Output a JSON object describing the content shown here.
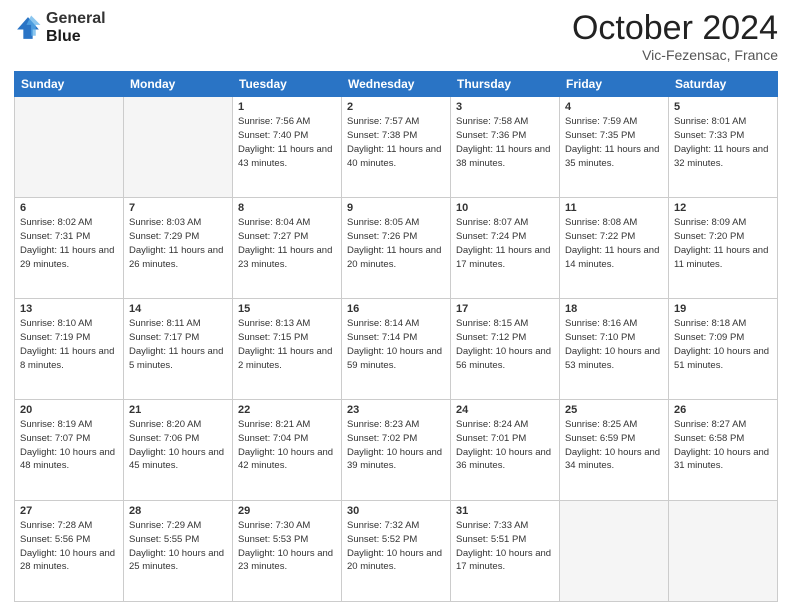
{
  "header": {
    "logo_line1": "General",
    "logo_line2": "Blue",
    "month": "October 2024",
    "location": "Vic-Fezensac, France"
  },
  "weekdays": [
    "Sunday",
    "Monday",
    "Tuesday",
    "Wednesday",
    "Thursday",
    "Friday",
    "Saturday"
  ],
  "weeks": [
    [
      {
        "day": "",
        "sunrise": "",
        "sunset": "",
        "daylight": ""
      },
      {
        "day": "",
        "sunrise": "",
        "sunset": "",
        "daylight": ""
      },
      {
        "day": "1",
        "sunrise": "Sunrise: 7:56 AM",
        "sunset": "Sunset: 7:40 PM",
        "daylight": "Daylight: 11 hours and 43 minutes."
      },
      {
        "day": "2",
        "sunrise": "Sunrise: 7:57 AM",
        "sunset": "Sunset: 7:38 PM",
        "daylight": "Daylight: 11 hours and 40 minutes."
      },
      {
        "day": "3",
        "sunrise": "Sunrise: 7:58 AM",
        "sunset": "Sunset: 7:36 PM",
        "daylight": "Daylight: 11 hours and 38 minutes."
      },
      {
        "day": "4",
        "sunrise": "Sunrise: 7:59 AM",
        "sunset": "Sunset: 7:35 PM",
        "daylight": "Daylight: 11 hours and 35 minutes."
      },
      {
        "day": "5",
        "sunrise": "Sunrise: 8:01 AM",
        "sunset": "Sunset: 7:33 PM",
        "daylight": "Daylight: 11 hours and 32 minutes."
      }
    ],
    [
      {
        "day": "6",
        "sunrise": "Sunrise: 8:02 AM",
        "sunset": "Sunset: 7:31 PM",
        "daylight": "Daylight: 11 hours and 29 minutes."
      },
      {
        "day": "7",
        "sunrise": "Sunrise: 8:03 AM",
        "sunset": "Sunset: 7:29 PM",
        "daylight": "Daylight: 11 hours and 26 minutes."
      },
      {
        "day": "8",
        "sunrise": "Sunrise: 8:04 AM",
        "sunset": "Sunset: 7:27 PM",
        "daylight": "Daylight: 11 hours and 23 minutes."
      },
      {
        "day": "9",
        "sunrise": "Sunrise: 8:05 AM",
        "sunset": "Sunset: 7:26 PM",
        "daylight": "Daylight: 11 hours and 20 minutes."
      },
      {
        "day": "10",
        "sunrise": "Sunrise: 8:07 AM",
        "sunset": "Sunset: 7:24 PM",
        "daylight": "Daylight: 11 hours and 17 minutes."
      },
      {
        "day": "11",
        "sunrise": "Sunrise: 8:08 AM",
        "sunset": "Sunset: 7:22 PM",
        "daylight": "Daylight: 11 hours and 14 minutes."
      },
      {
        "day": "12",
        "sunrise": "Sunrise: 8:09 AM",
        "sunset": "Sunset: 7:20 PM",
        "daylight": "Daylight: 11 hours and 11 minutes."
      }
    ],
    [
      {
        "day": "13",
        "sunrise": "Sunrise: 8:10 AM",
        "sunset": "Sunset: 7:19 PM",
        "daylight": "Daylight: 11 hours and 8 minutes."
      },
      {
        "day": "14",
        "sunrise": "Sunrise: 8:11 AM",
        "sunset": "Sunset: 7:17 PM",
        "daylight": "Daylight: 11 hours and 5 minutes."
      },
      {
        "day": "15",
        "sunrise": "Sunrise: 8:13 AM",
        "sunset": "Sunset: 7:15 PM",
        "daylight": "Daylight: 11 hours and 2 minutes."
      },
      {
        "day": "16",
        "sunrise": "Sunrise: 8:14 AM",
        "sunset": "Sunset: 7:14 PM",
        "daylight": "Daylight: 10 hours and 59 minutes."
      },
      {
        "day": "17",
        "sunrise": "Sunrise: 8:15 AM",
        "sunset": "Sunset: 7:12 PM",
        "daylight": "Daylight: 10 hours and 56 minutes."
      },
      {
        "day": "18",
        "sunrise": "Sunrise: 8:16 AM",
        "sunset": "Sunset: 7:10 PM",
        "daylight": "Daylight: 10 hours and 53 minutes."
      },
      {
        "day": "19",
        "sunrise": "Sunrise: 8:18 AM",
        "sunset": "Sunset: 7:09 PM",
        "daylight": "Daylight: 10 hours and 51 minutes."
      }
    ],
    [
      {
        "day": "20",
        "sunrise": "Sunrise: 8:19 AM",
        "sunset": "Sunset: 7:07 PM",
        "daylight": "Daylight: 10 hours and 48 minutes."
      },
      {
        "day": "21",
        "sunrise": "Sunrise: 8:20 AM",
        "sunset": "Sunset: 7:06 PM",
        "daylight": "Daylight: 10 hours and 45 minutes."
      },
      {
        "day": "22",
        "sunrise": "Sunrise: 8:21 AM",
        "sunset": "Sunset: 7:04 PM",
        "daylight": "Daylight: 10 hours and 42 minutes."
      },
      {
        "day": "23",
        "sunrise": "Sunrise: 8:23 AM",
        "sunset": "Sunset: 7:02 PM",
        "daylight": "Daylight: 10 hours and 39 minutes."
      },
      {
        "day": "24",
        "sunrise": "Sunrise: 8:24 AM",
        "sunset": "Sunset: 7:01 PM",
        "daylight": "Daylight: 10 hours and 36 minutes."
      },
      {
        "day": "25",
        "sunrise": "Sunrise: 8:25 AM",
        "sunset": "Sunset: 6:59 PM",
        "daylight": "Daylight: 10 hours and 34 minutes."
      },
      {
        "day": "26",
        "sunrise": "Sunrise: 8:27 AM",
        "sunset": "Sunset: 6:58 PM",
        "daylight": "Daylight: 10 hours and 31 minutes."
      }
    ],
    [
      {
        "day": "27",
        "sunrise": "Sunrise: 7:28 AM",
        "sunset": "Sunset: 5:56 PM",
        "daylight": "Daylight: 10 hours and 28 minutes."
      },
      {
        "day": "28",
        "sunrise": "Sunrise: 7:29 AM",
        "sunset": "Sunset: 5:55 PM",
        "daylight": "Daylight: 10 hours and 25 minutes."
      },
      {
        "day": "29",
        "sunrise": "Sunrise: 7:30 AM",
        "sunset": "Sunset: 5:53 PM",
        "daylight": "Daylight: 10 hours and 23 minutes."
      },
      {
        "day": "30",
        "sunrise": "Sunrise: 7:32 AM",
        "sunset": "Sunset: 5:52 PM",
        "daylight": "Daylight: 10 hours and 20 minutes."
      },
      {
        "day": "31",
        "sunrise": "Sunrise: 7:33 AM",
        "sunset": "Sunset: 5:51 PM",
        "daylight": "Daylight: 10 hours and 17 minutes."
      },
      {
        "day": "",
        "sunrise": "",
        "sunset": "",
        "daylight": ""
      },
      {
        "day": "",
        "sunrise": "",
        "sunset": "",
        "daylight": ""
      }
    ]
  ]
}
